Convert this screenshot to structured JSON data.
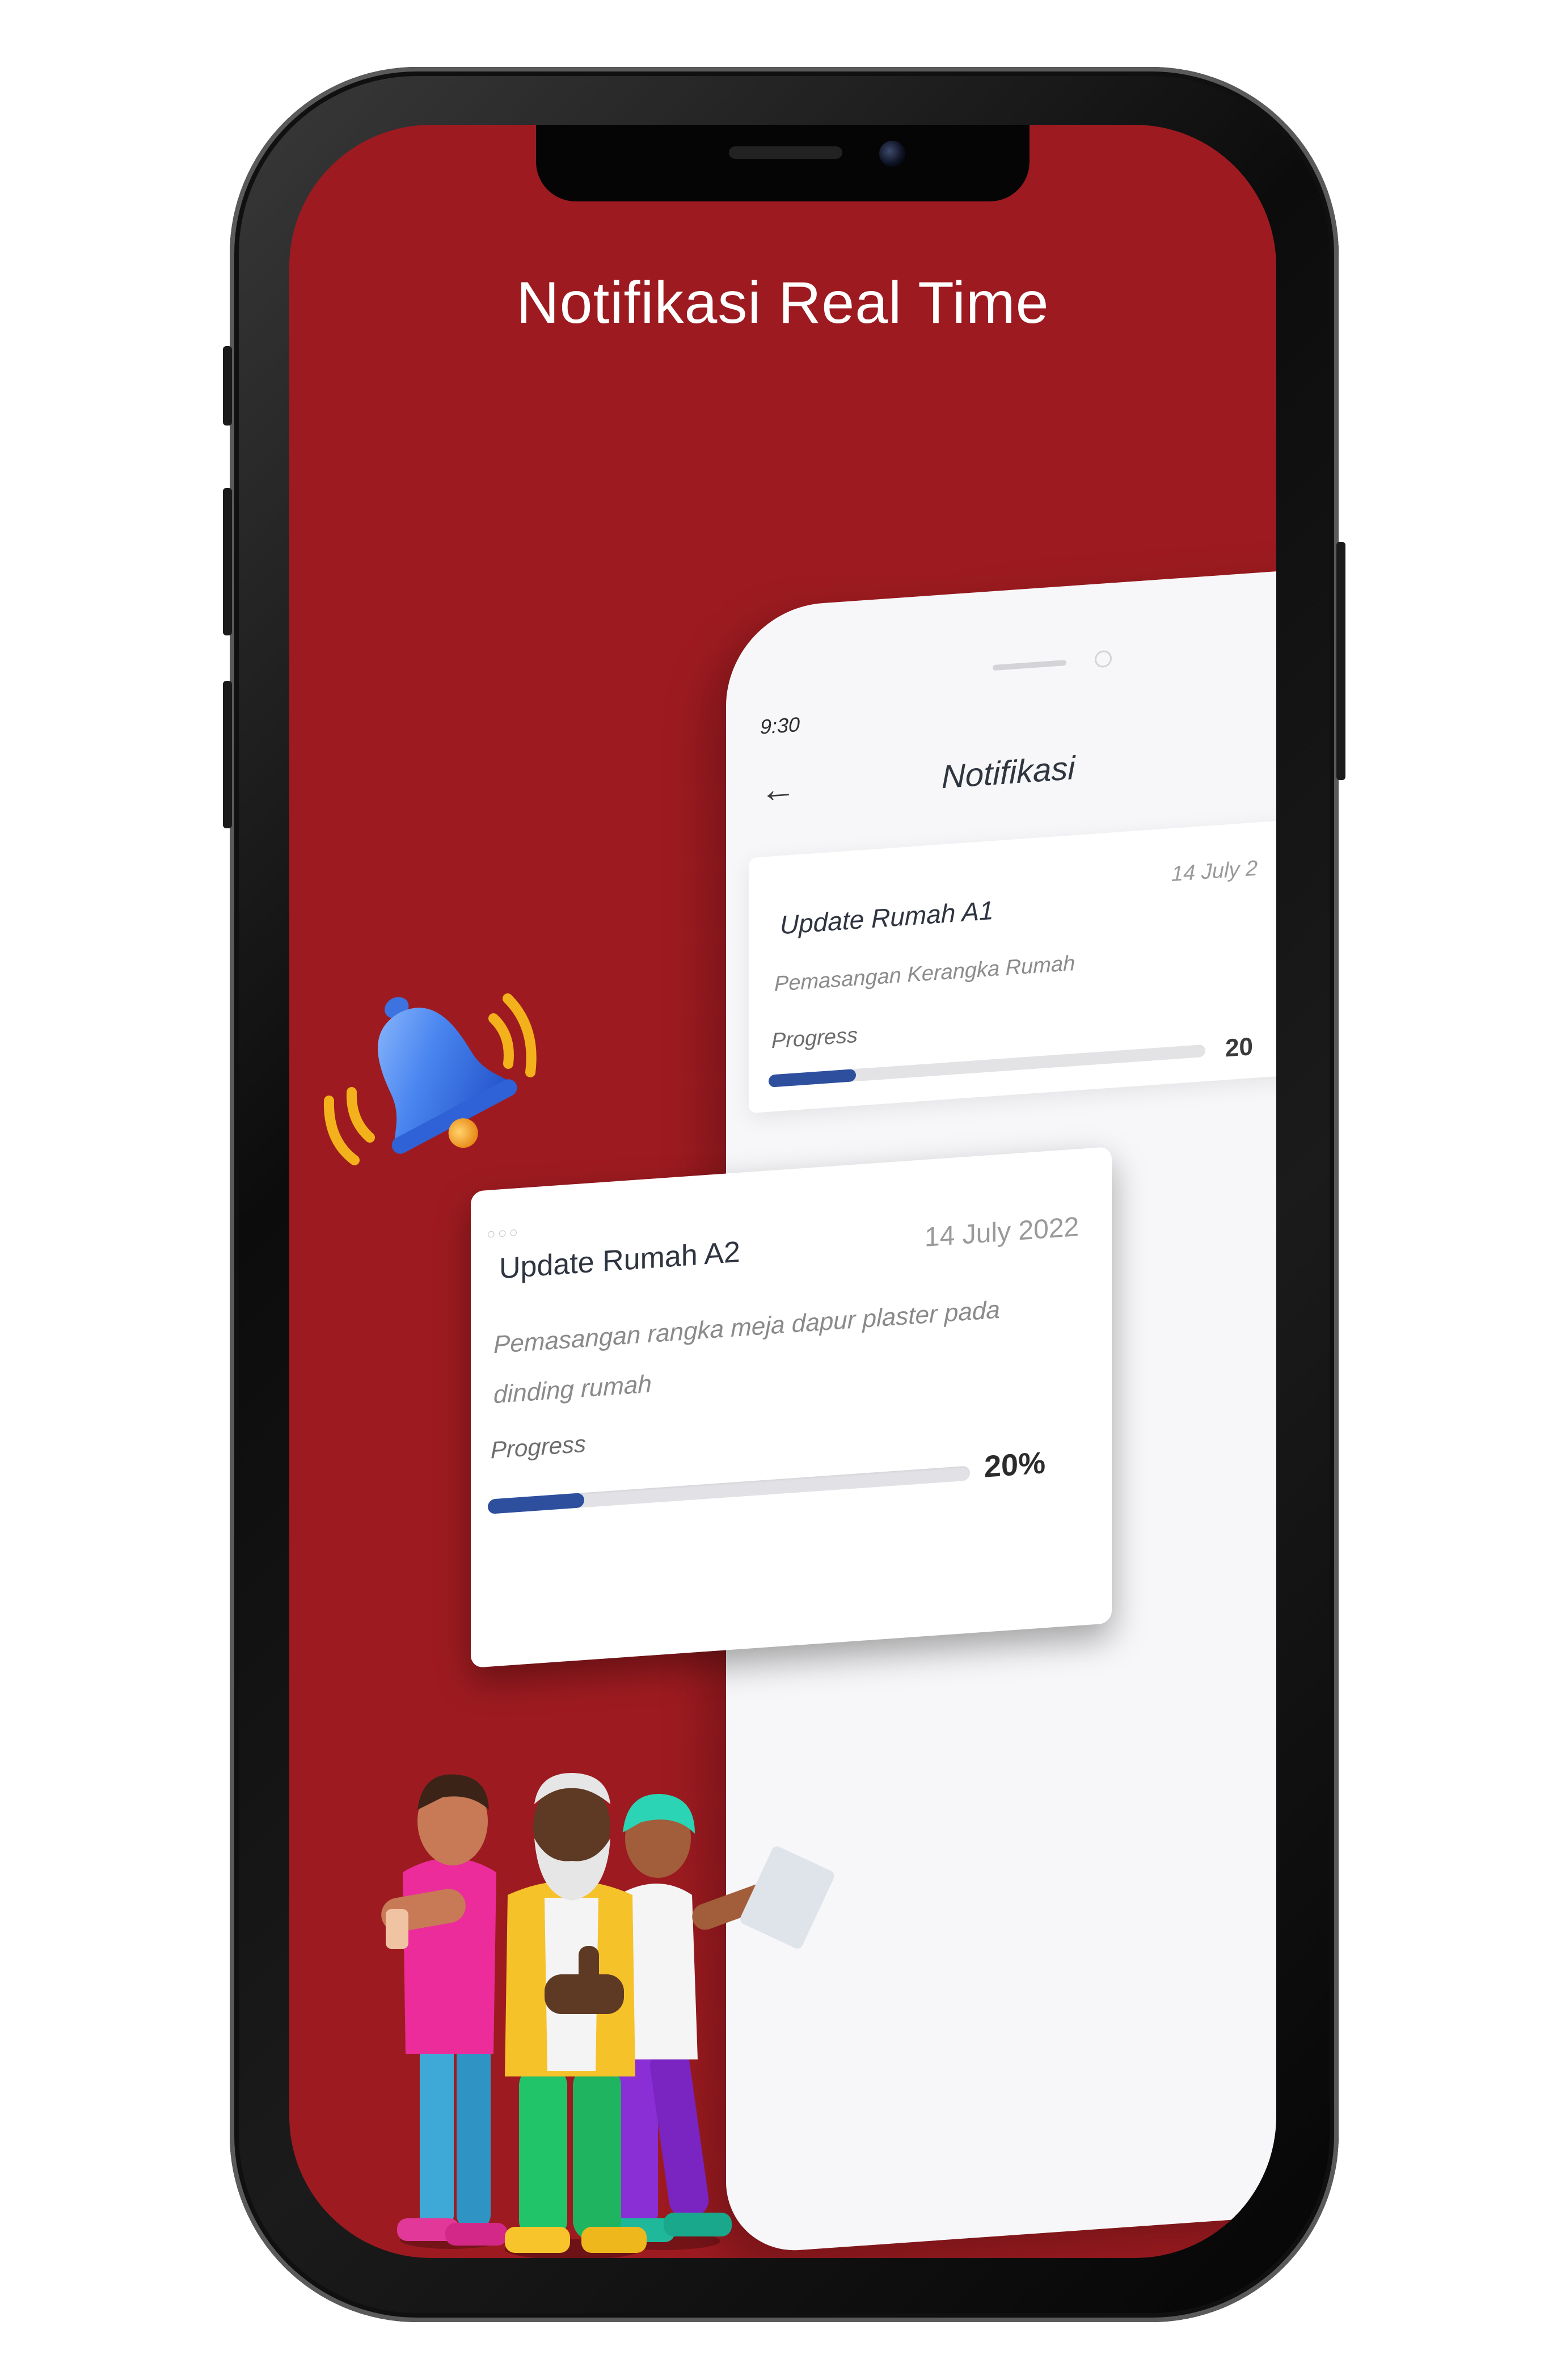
{
  "hero": {
    "title": "Notifikasi Real Time"
  },
  "app": {
    "status_time": "9:30",
    "back_icon": "arrow-left-icon",
    "screen_title": "Notifikasi"
  },
  "notifications": [
    {
      "title": "Update Rumah A1",
      "date": "14 July 2",
      "description": "Pemasangan Kerangka Rumah",
      "progress_label": "Progress",
      "progress": 0.2,
      "progress_text": "20"
    },
    {
      "title": "Update Rumah A2",
      "date": "14 July 2022",
      "description": "Pemasangan rangka meja dapur plaster pada dinding rumah",
      "progress_label": "Progress",
      "progress": 0.2,
      "progress_text": "20%"
    }
  ],
  "colors": {
    "background": "#9d1b20",
    "progress_fill": "#2e4f9e",
    "progress_track": "#e2e2e6"
  },
  "illustrations": {
    "bell": "notification-bell-icon",
    "people": "three-people-illustration"
  }
}
